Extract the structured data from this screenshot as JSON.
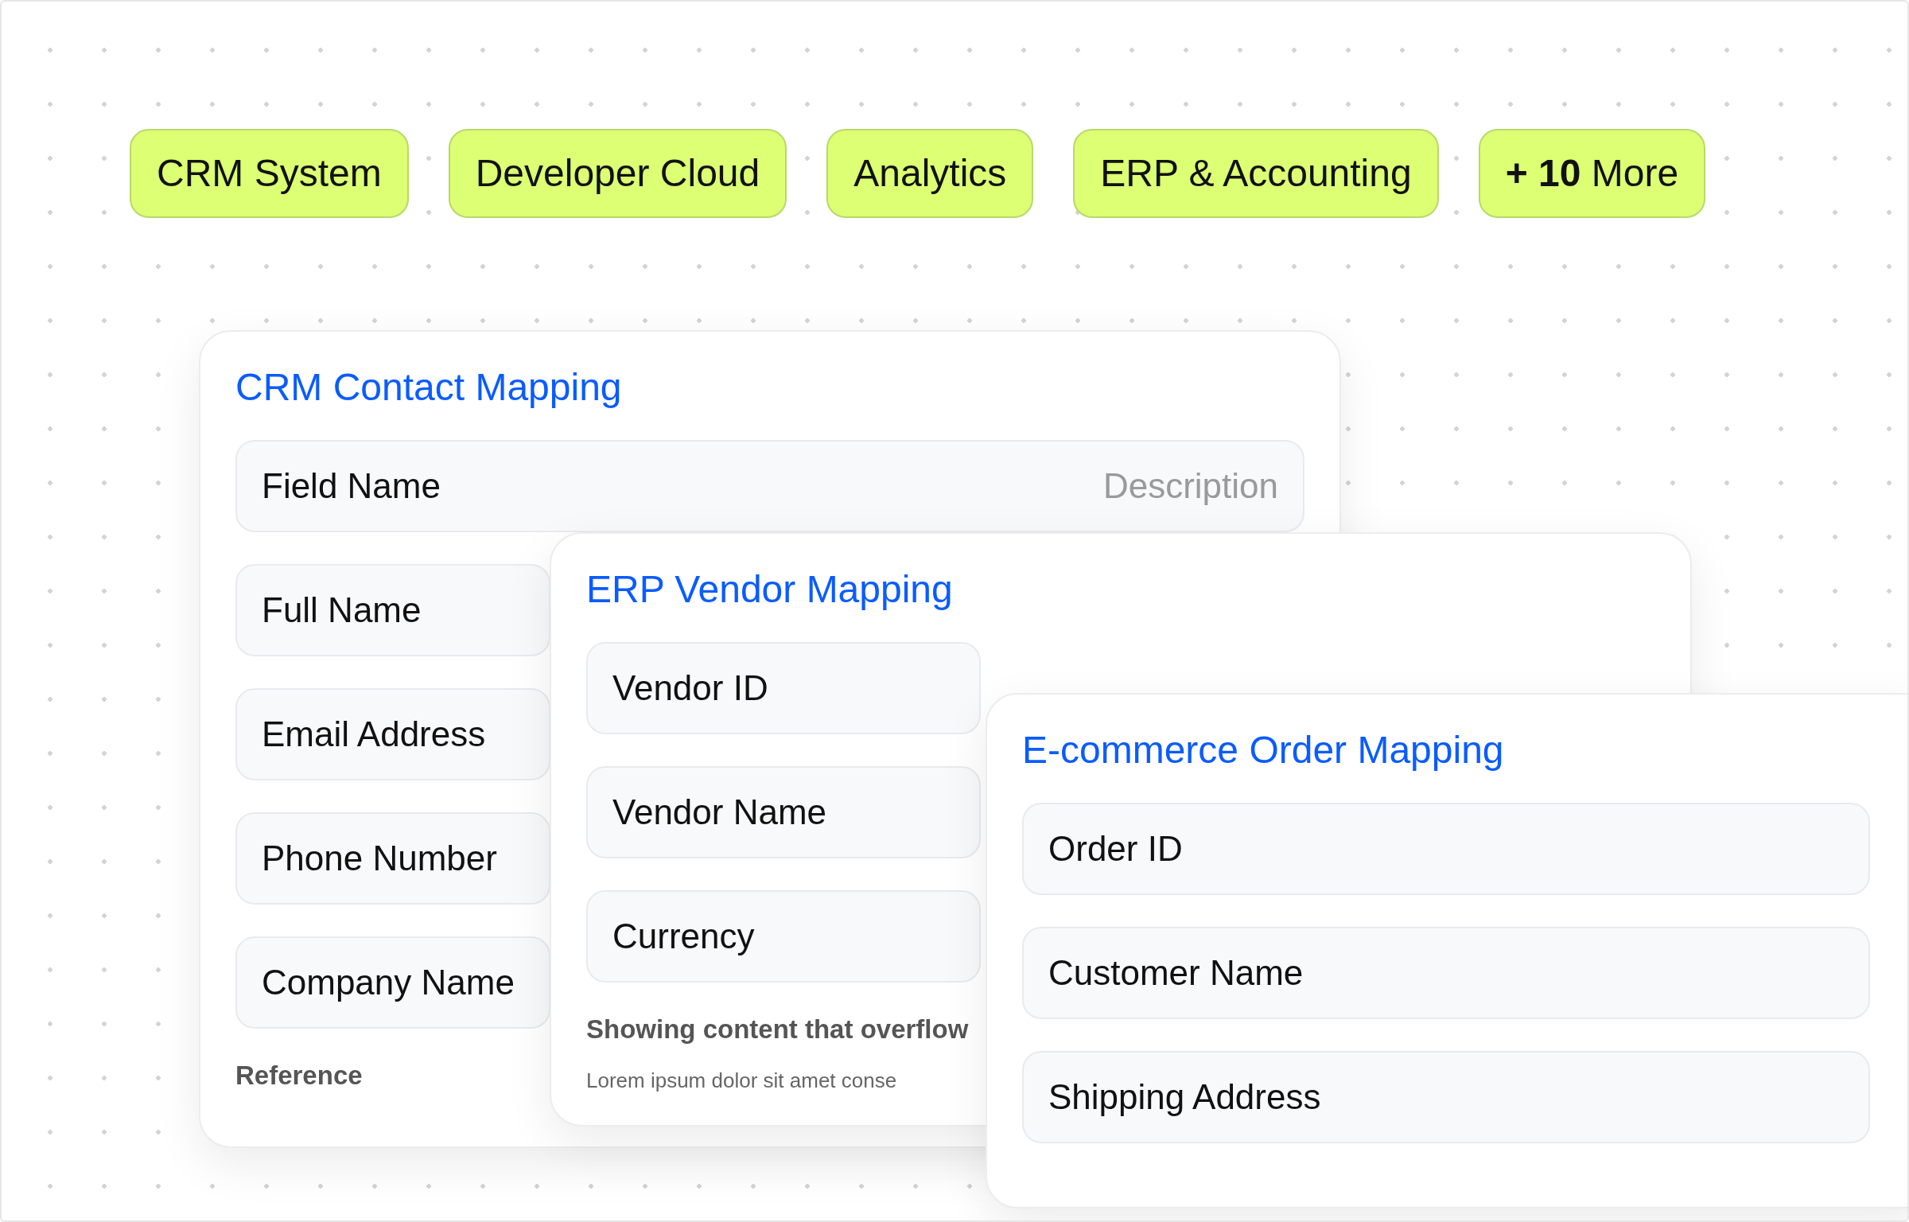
{
  "tags": [
    {
      "label": "CRM System"
    },
    {
      "label": "Developer Cloud"
    },
    {
      "label": "Analytics"
    },
    {
      "label": "ERP & Accounting"
    },
    {
      "label": "**+ 10** More"
    }
  ],
  "cards": [
    {
      "title": "CRM Contact Mapping",
      "rows": [
        {
          "kind": "field",
          "label": "Field Name",
          "description": "Description",
          "blurred": false
        },
        {
          "kind": "field",
          "label": "Full Name",
          "blurred": false
        },
        {
          "kind": "field",
          "label": "Email Address",
          "blurred": false
        },
        {
          "kind": "field",
          "label": "Phone Number",
          "blurred": false
        },
        {
          "kind": "field",
          "label": "Company Name",
          "blurred": false
        },
        {
          "kind": "text",
          "label": "Reference",
          "blurred": false
        }
      ]
    },
    {
      "title": "ERP Vendor Mapping",
      "rows": [
        {
          "kind": "field",
          "label": "Vendor ID",
          "blurred": false
        },
        {
          "kind": "field",
          "label": "Vendor Name",
          "blurred": false
        },
        {
          "kind": "field",
          "label": "Currency",
          "blurred": false
        },
        {
          "kind": "text",
          "label": "Showing content that overflow",
          "blurred": false
        },
        {
          "kind": "subtext",
          "label": "Lorem ipsum dolor sit amet conse",
          "blurred": false
        }
      ]
    },
    {
      "title": "E-commerce Order Mapping",
      "rows": [
        {
          "kind": "field",
          "label": "Order ID",
          "blurred": false
        },
        {
          "kind": "field",
          "label": "Customer Name",
          "blurred": false
        },
        {
          "kind": "field",
          "label": "Shipping Address",
          "blurred": false
        }
      ]
    }
  ]
}
